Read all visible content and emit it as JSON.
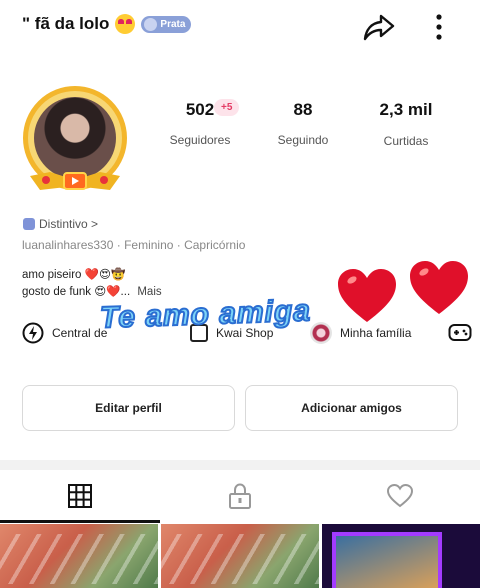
{
  "header": {
    "title": "\" fã da lolo",
    "badge_label": "Prata"
  },
  "profile": {
    "new_followers_badge": "+5",
    "stats": [
      {
        "value": "502",
        "label": "Seguidores"
      },
      {
        "value": "88",
        "label": "Seguindo"
      },
      {
        "value": "2,3 mil",
        "label": "Curtidas"
      }
    ],
    "distintivo_label": "Distintivo >",
    "meta": "luanalinhares330  ·  Feminino  ·  Capricórnio",
    "bio_line1": "amo piseiro ❤️😍🤠",
    "bio_line2": "gosto de funk 😍❤️...",
    "bio_more": "Mais"
  },
  "links": {
    "central": "Central de",
    "kwai_shop": "Kwai Shop",
    "family": "Minha família"
  },
  "overlay": {
    "text": "Te amo amiga"
  },
  "actions": {
    "edit": "Editar perfil",
    "add_friends": "Adicionar amigos"
  },
  "tabs": [
    "grid",
    "private",
    "liked"
  ],
  "colors": {
    "accent_gold": "#f3b62c",
    "overlay_text": "#7dd3f7",
    "heart": "#e0102a",
    "badge": "#8aa0d8"
  }
}
